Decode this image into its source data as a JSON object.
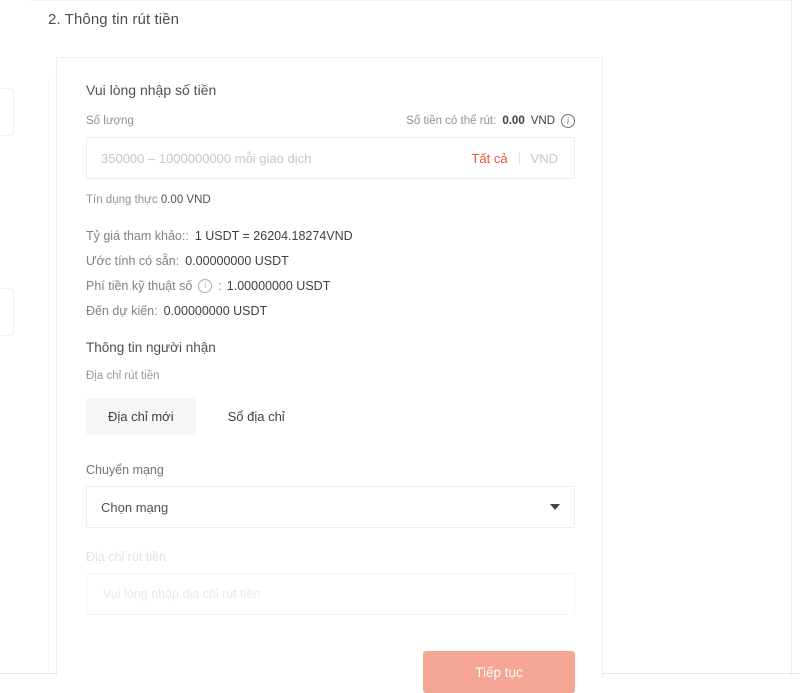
{
  "section": {
    "title": "2. Thông tin rút tiền"
  },
  "amount": {
    "block_title": "Vui lòng nhập số tiền",
    "quantity_label": "Số lượng",
    "available_label": "Số tiền có thể rút:",
    "available_value": "0.00",
    "available_unit": "VND",
    "available_info_icon": "info-circle-icon",
    "input_placeholder": "350000 – 1000000000 mỗi giao dịch",
    "input_value": "",
    "max_label": "Tất cả",
    "currency_label": "VND",
    "credit_label": "Tín dụng thực",
    "credit_value": "0.00 VND"
  },
  "details": [
    {
      "key": "Tỷ giá tham khảo::",
      "value": "1 USDT = 26204.18274VND",
      "has_info_icon": false
    },
    {
      "key": "Ước tính có sẵn:",
      "value": "0.00000000 USDT",
      "has_info_icon": false
    },
    {
      "key": "Phí tiền kỹ thuật số",
      "value": "1.00000000 USDT",
      "has_info_icon": true,
      "mid": ":"
    },
    {
      "key": "Đến dự kiến:",
      "value": "0.00000000 USDT",
      "has_info_icon": false
    }
  ],
  "recipient": {
    "title": "Thông tin người nhận",
    "address_label": "Địa chỉ rút tiền",
    "tabs": [
      {
        "label": "Địa chỉ mới",
        "active": true
      },
      {
        "label": "Sổ địa chỉ",
        "active": false
      }
    ]
  },
  "network": {
    "label": "Chuyển mạng",
    "selected": "Chọn mạng",
    "caret_icon": "chevron-down-icon"
  },
  "withdraw_address": {
    "label": "Địa chỉ rút tiền",
    "placeholder": "Vui lòng nhập địa chỉ rút tiền",
    "value": "",
    "disabled": true
  },
  "submit": {
    "label": "Tiếp tục",
    "enabled": false,
    "color": "#f4a593"
  },
  "colors": {
    "accent": "#e8533c",
    "text": "#3d4145",
    "muted": "#8d9299",
    "border": "#ededed",
    "button_disabled": "#f4a593"
  }
}
